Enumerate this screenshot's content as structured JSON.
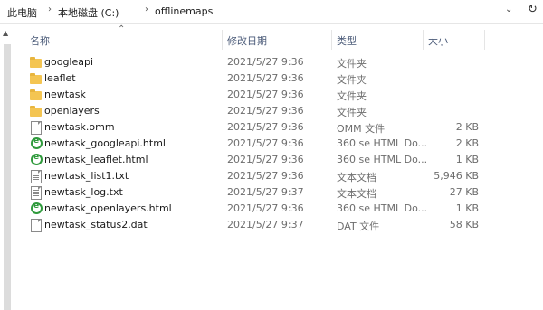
{
  "address": {
    "crumbs": [
      "此电脑",
      "本地磁盘 (C:)",
      "offlinemaps"
    ],
    "separator_icon": "chevron-right-icon",
    "dropdown_icon": "chevron-down-icon",
    "refresh_icon": "refresh-icon"
  },
  "columns": {
    "name": "名称",
    "modified": "修改日期",
    "type": "类型",
    "size": "大小"
  },
  "files": [
    {
      "name": "googleapi",
      "date": "2021/5/27 9:36",
      "type": "文件夹",
      "size": "",
      "icon": "folder-icon"
    },
    {
      "name": "leaflet",
      "date": "2021/5/27 9:36",
      "type": "文件夹",
      "size": "",
      "icon": "folder-icon"
    },
    {
      "name": "newtask",
      "date": "2021/5/27 9:36",
      "type": "文件夹",
      "size": "",
      "icon": "folder-icon"
    },
    {
      "name": "openlayers",
      "date": "2021/5/27 9:36",
      "type": "文件夹",
      "size": "",
      "icon": "folder-icon"
    },
    {
      "name": "newtask.omm",
      "date": "2021/5/27 9:36",
      "type": "OMM 文件",
      "size": "2 KB",
      "icon": "file-icon"
    },
    {
      "name": "newtask_googleapi.html",
      "date": "2021/5/27 9:36",
      "type": "360 se HTML Do...",
      "size": "2 KB",
      "icon": "html-file-icon"
    },
    {
      "name": "newtask_leaflet.html",
      "date": "2021/5/27 9:36",
      "type": "360 se HTML Do...",
      "size": "1 KB",
      "icon": "html-file-icon"
    },
    {
      "name": "newtask_list1.txt",
      "date": "2021/5/27 9:36",
      "type": "文本文档",
      "size": "5,946 KB",
      "icon": "text-file-icon"
    },
    {
      "name": "newtask_log.txt",
      "date": "2021/5/27 9:37",
      "type": "文本文档",
      "size": "27 KB",
      "icon": "text-file-icon"
    },
    {
      "name": "newtask_openlayers.html",
      "date": "2021/5/27 9:36",
      "type": "360 se HTML Do...",
      "size": "1 KB",
      "icon": "html-file-icon"
    },
    {
      "name": "newtask_status2.dat",
      "date": "2021/5/27 9:37",
      "type": "DAT 文件",
      "size": "58 KB",
      "icon": "file-icon"
    }
  ]
}
